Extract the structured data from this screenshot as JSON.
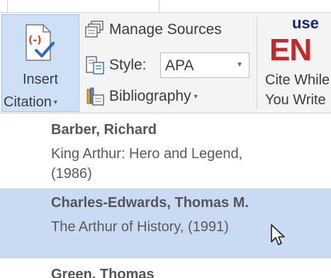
{
  "ribbon": {
    "insert_citation": {
      "line1": "Insert",
      "line2": "Citation",
      "icon": "insert-citation-icon"
    },
    "manage_sources": {
      "label": "Manage Sources",
      "icon": "manage-sources-icon"
    },
    "style": {
      "label": "Style:",
      "value": "APA",
      "icon": "style-icon"
    },
    "bibliography": {
      "label": "Bibliography",
      "icon": "bibliography-icon"
    },
    "endnote": {
      "logo_top": "use",
      "logo_big": "EN",
      "line1": "Cite While",
      "line2": "You Write"
    }
  },
  "citations": [
    {
      "author": "Barber, Richard",
      "title_line1": "King Arthur: Hero and Legend,",
      "title_line2": "(1986)",
      "hovered": false
    },
    {
      "author": "Charles-Edwards, Thomas M.",
      "title_line1": "The Arthur of History, (1991)",
      "hovered": true
    },
    {
      "author": "Green, Thomas",
      "hovered": false
    }
  ],
  "colors": {
    "hover_bg": "#c9dbf2",
    "insert_bg": "#cde0f5",
    "endnote_red": "#c62828",
    "endnote_navy": "#1a237e"
  }
}
